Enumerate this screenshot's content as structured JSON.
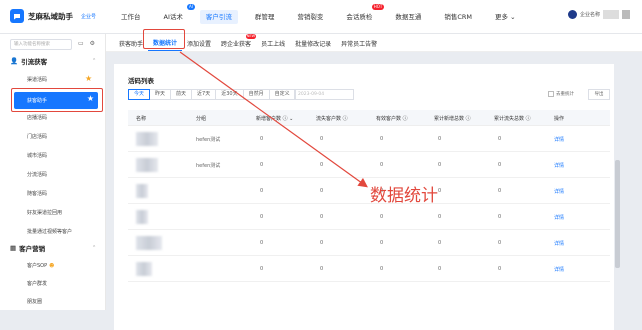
{
  "app": {
    "title": "芝麻私域助手",
    "tag": "企业号"
  },
  "topnav": [
    {
      "label": "工作台"
    },
    {
      "label": "AI话术",
      "badge": "AI"
    },
    {
      "label": "客户引流",
      "active": true
    },
    {
      "label": "群管理"
    },
    {
      "label": "营销裂变"
    },
    {
      "label": "会话质检",
      "badge": "HOT"
    },
    {
      "label": "数据互通"
    },
    {
      "label": "销售CRM"
    },
    {
      "label": "更多 ⌄"
    }
  ],
  "user": {
    "name": "企业名称"
  },
  "sidebar": {
    "search_placeholder": "输入功能名称搜索",
    "groups": [
      {
        "label": "引流获客",
        "items": [
          "渠道活码",
          "获客助手",
          "店播活码",
          "门店活码",
          "城市活码",
          "分流活码",
          "随客活码",
          "好友渠道拉回用",
          "批量通过视频等客户"
        ]
      },
      {
        "label": "客户营销",
        "items": [
          "客户SOP",
          "客户群发",
          "朋友圈"
        ]
      }
    ],
    "active_item": "获客助手"
  },
  "subtabs": [
    {
      "label": "获客助手"
    },
    {
      "label": "数据统计",
      "active": true
    },
    {
      "label": "添加设置"
    },
    {
      "label": "跨企业获客",
      "badge": "NEW"
    },
    {
      "label": "员工上线"
    },
    {
      "label": "批量修改记录"
    },
    {
      "label": "异常员工告警"
    }
  ],
  "card": {
    "title": "活码列表",
    "filters": [
      "今天",
      "昨天",
      "前天",
      "近7天",
      "近30天",
      "自然月",
      "自定义"
    ],
    "active_filter": "今天",
    "date_placeholder": "2023-09-04",
    "checkbox_label": "去重统计",
    "export_label": "导出",
    "columns": [
      "名称",
      "分组",
      "新增客户数 ⓘ ⌄",
      "流失客户数 ⓘ",
      "有效客户数 ⓘ",
      "累计新增总数 ⓘ",
      "累计流失总数 ⓘ",
      "操作"
    ],
    "rows": [
      {
        "group": "hefen测试",
        "v1": "0",
        "v2": "0",
        "v3": "0",
        "v4": "0",
        "v5": "0",
        "action": "详情"
      },
      {
        "group": "hefen测试",
        "v1": "0",
        "v2": "0",
        "v3": "0",
        "v4": "0",
        "v5": "0",
        "action": "详情"
      },
      {
        "group": "",
        "v1": "0",
        "v2": "0",
        "v3": "0",
        "v4": "0",
        "v5": "0",
        "action": "详情"
      },
      {
        "group": "",
        "v1": "0",
        "v2": "0",
        "v3": "0",
        "v4": "0",
        "v5": "0",
        "action": "详情"
      },
      {
        "group": "",
        "v1": "0",
        "v2": "0",
        "v3": "0",
        "v4": "0",
        "v5": "0",
        "action": "详情"
      },
      {
        "group": "",
        "v1": "0",
        "v2": "0",
        "v3": "0",
        "v4": "0",
        "v5": "0",
        "action": "详情"
      }
    ]
  },
  "annotation": {
    "text": "数据统计",
    "color": "#e2483d"
  },
  "colors": {
    "primary": "#1677ff",
    "highlight": "#e2483d"
  }
}
